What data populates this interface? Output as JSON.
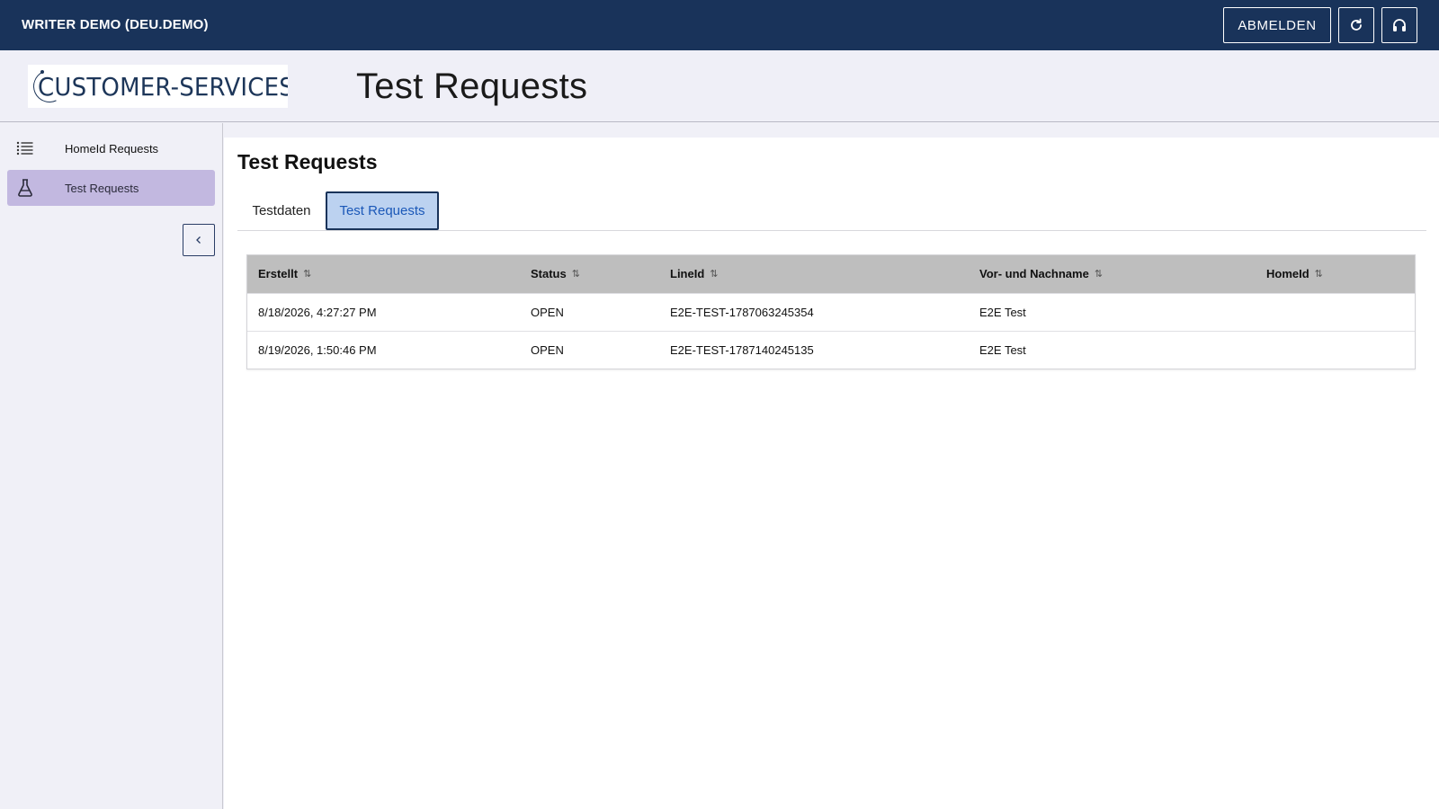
{
  "topbar": {
    "app_title": "WRITER DEMO (DEU.DEMO)",
    "logout_label": "ABMELDEN",
    "refresh_icon": "refresh-icon",
    "support_icon": "headset-icon"
  },
  "header": {
    "logo_text": "CUSTOMER-SERVICES",
    "page_title": "Test Requests"
  },
  "sidebar": {
    "items": [
      {
        "label": "HomeId Requests",
        "icon": "list-icon",
        "active": false
      },
      {
        "label": "Test Requests",
        "icon": "flask-icon",
        "active": true
      }
    ],
    "collapse_icon": "chevron-left-icon"
  },
  "main": {
    "title": "Test Requests",
    "tabs": [
      {
        "label": "Testdaten",
        "active": false
      },
      {
        "label": "Test Requests",
        "active": true
      }
    ],
    "table": {
      "columns": [
        "Erstellt",
        "Status",
        "LineId",
        "Vor- und Nachname",
        "HomeId"
      ],
      "sort_glyph": "⇅",
      "rows": [
        [
          "8/18/2026, 4:27:27 PM",
          "OPEN",
          "E2E-TEST-1787063245354",
          "E2E Test",
          ""
        ],
        [
          "8/19/2026, 1:50:46 PM",
          "OPEN",
          "E2E-TEST-1787140245135",
          "E2E Test",
          ""
        ]
      ]
    }
  },
  "colors": {
    "topbar_bg": "#19335a",
    "active_nav_bg": "#c2b8e0",
    "active_tab_bg": "#bcd2f0",
    "table_header_bg": "#bebebe"
  }
}
